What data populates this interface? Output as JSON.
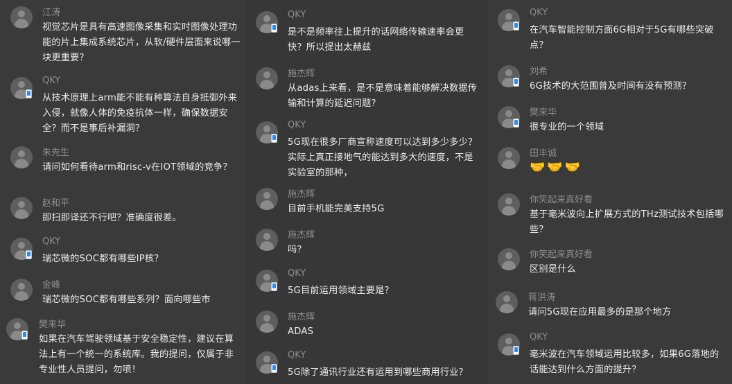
{
  "columns": [
    {
      "messages": [
        {
          "name": "江涛",
          "device_badge": false,
          "text": "视觉芯片是具有高速图像采集和实时图像处理功能的片上集成系统芯片，从软/硬件层面来说哪一块更重要？"
        },
        {
          "name": "QKY",
          "device_badge": true,
          "text": "从技术原理上arm能不能有种算法自身抵御外来入侵，就像人体的免疫抗体一样，确保数据安全？而不是事后补漏洞？"
        },
        {
          "name": "朱先生",
          "device_badge": false,
          "text": "请问如何看待arm和risc-v在IOT领域的竞争？"
        },
        {
          "name": "赵和平",
          "device_badge": false,
          "text": "即扫即译还不行吧？准确度很差。"
        },
        {
          "name": "QKY",
          "device_badge": true,
          "text": "瑞芯微的SOC都有哪些IP核？"
        },
        {
          "name": "金峰",
          "device_badge": false,
          "text": "瑞芯微的SOC都有哪些系列？面向哪些市"
        },
        {
          "name": "樊来华",
          "device_badge": true,
          "text": "如果在汽车驾驶领域基于安全稳定性，建议在算法上有一个统一的系统库。我的提问，仅属于非专业性人员提问，勿喷！"
        }
      ]
    },
    {
      "messages": [
        {
          "name": "QKY",
          "device_badge": true,
          "text": "是不是频率往上提升的话网络传输速率会更快？所以提出太赫兹"
        },
        {
          "name": "施杰辉",
          "device_badge": false,
          "text": "从adas上来看，是不是意味着能够解决数据传输和计算的延迟问题？"
        },
        {
          "name": "QKY",
          "device_badge": true,
          "text": "5G现在很多厂商宣称速度可以达到多少多少？实际上真正接地气的能达到多大的速度，不是实验室的那种，"
        },
        {
          "name": "施杰辉",
          "device_badge": false,
          "text": "目前手机能完美支持5G"
        },
        {
          "name": "施杰辉",
          "device_badge": false,
          "text": "吗？"
        },
        {
          "name": "QKY",
          "device_badge": true,
          "text": "5G目前运用领域主要是？"
        },
        {
          "name": "施杰辉",
          "device_badge": false,
          "text": "ADAS"
        },
        {
          "name": "QKY",
          "device_badge": true,
          "text": "5G除了通讯行业还有运用到哪些商用行业？"
        }
      ]
    },
    {
      "messages": [
        {
          "name": "QKY",
          "device_badge": true,
          "text": "在汽车智能控制方面6G相对于5G有哪些突破点？"
        },
        {
          "name": "刘希",
          "device_badge": true,
          "text": "6G技术的大范围普及时间有没有预测？"
        },
        {
          "name": "樊来华",
          "device_badge": true,
          "text": "很专业的一个领域"
        },
        {
          "name": "田丰诚",
          "device_badge": false,
          "text": "",
          "emoji": "🤝🤝🤝"
        },
        {
          "name": "你笑起来真好看",
          "device_badge": false,
          "text": "基于毫米波向上扩展方式的THz测试技术包括哪些？"
        },
        {
          "name": "你笑起来真好看",
          "device_badge": false,
          "text": "区别是什么"
        },
        {
          "name": "蒋洪涛",
          "device_badge": false,
          "text": "请问5G现在应用最多的是那个地方"
        },
        {
          "name": "QKY",
          "device_badge": true,
          "text": "毫米波在汽车领域运用比较多，如果6G落地的话能达到什么方面的提升？"
        }
      ]
    }
  ]
}
